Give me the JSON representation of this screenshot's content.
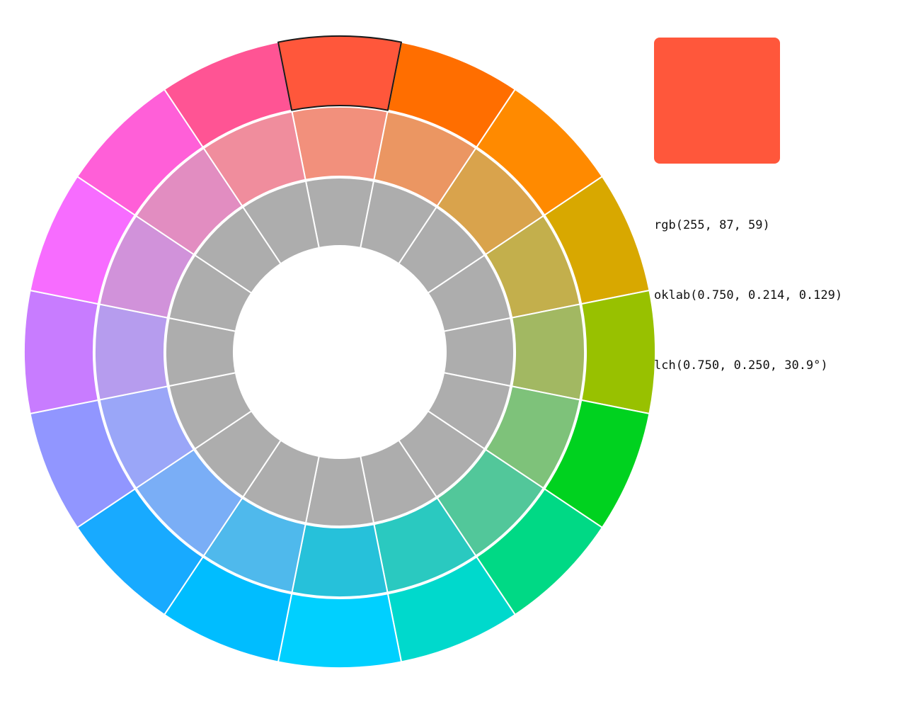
{
  "selected": {
    "ring": 0,
    "index": 0,
    "color": "#ff573b",
    "rgb_text": "rgb(255, 87, 59)",
    "oklab_text": "oklab(0.750, 0.214, 0.129)",
    "lch_text": "lch(0.750, 0.250, 30.9°)"
  },
  "wheel": {
    "segments_per_ring": 16,
    "rings": [
      {
        "name": "outer",
        "colors": [
          "#ff573b",
          "#ff6e00",
          "#ff8a00",
          "#d8a800",
          "#98c100",
          "#00d21f",
          "#00d985",
          "#00d9cc",
          "#00d0ff",
          "#00bdff",
          "#18aaff",
          "#9196ff",
          "#c87cff",
          "#f76cff",
          "#ff5fd8",
          "#ff5494"
        ]
      },
      {
        "name": "middle",
        "colors": [
          "#f2907c",
          "#eb9662",
          "#d9a34c",
          "#c3af4c",
          "#a2b862",
          "#7ec27a",
          "#52c79a",
          "#2ac9c0",
          "#26c1da",
          "#4fb9ec",
          "#7aaef6",
          "#9aa6f8",
          "#b69cee",
          "#d192da",
          "#e28dc1",
          "#f08d9d"
        ]
      },
      {
        "name": "inner",
        "colors": [
          "#adadad",
          "#adadad",
          "#adadad",
          "#adadad",
          "#adadad",
          "#adadad",
          "#adadad",
          "#adadad",
          "#adadad",
          "#adadad",
          "#adadad",
          "#adadad",
          "#adadad",
          "#adadad",
          "#adadad",
          "#adadad"
        ]
      }
    ]
  }
}
